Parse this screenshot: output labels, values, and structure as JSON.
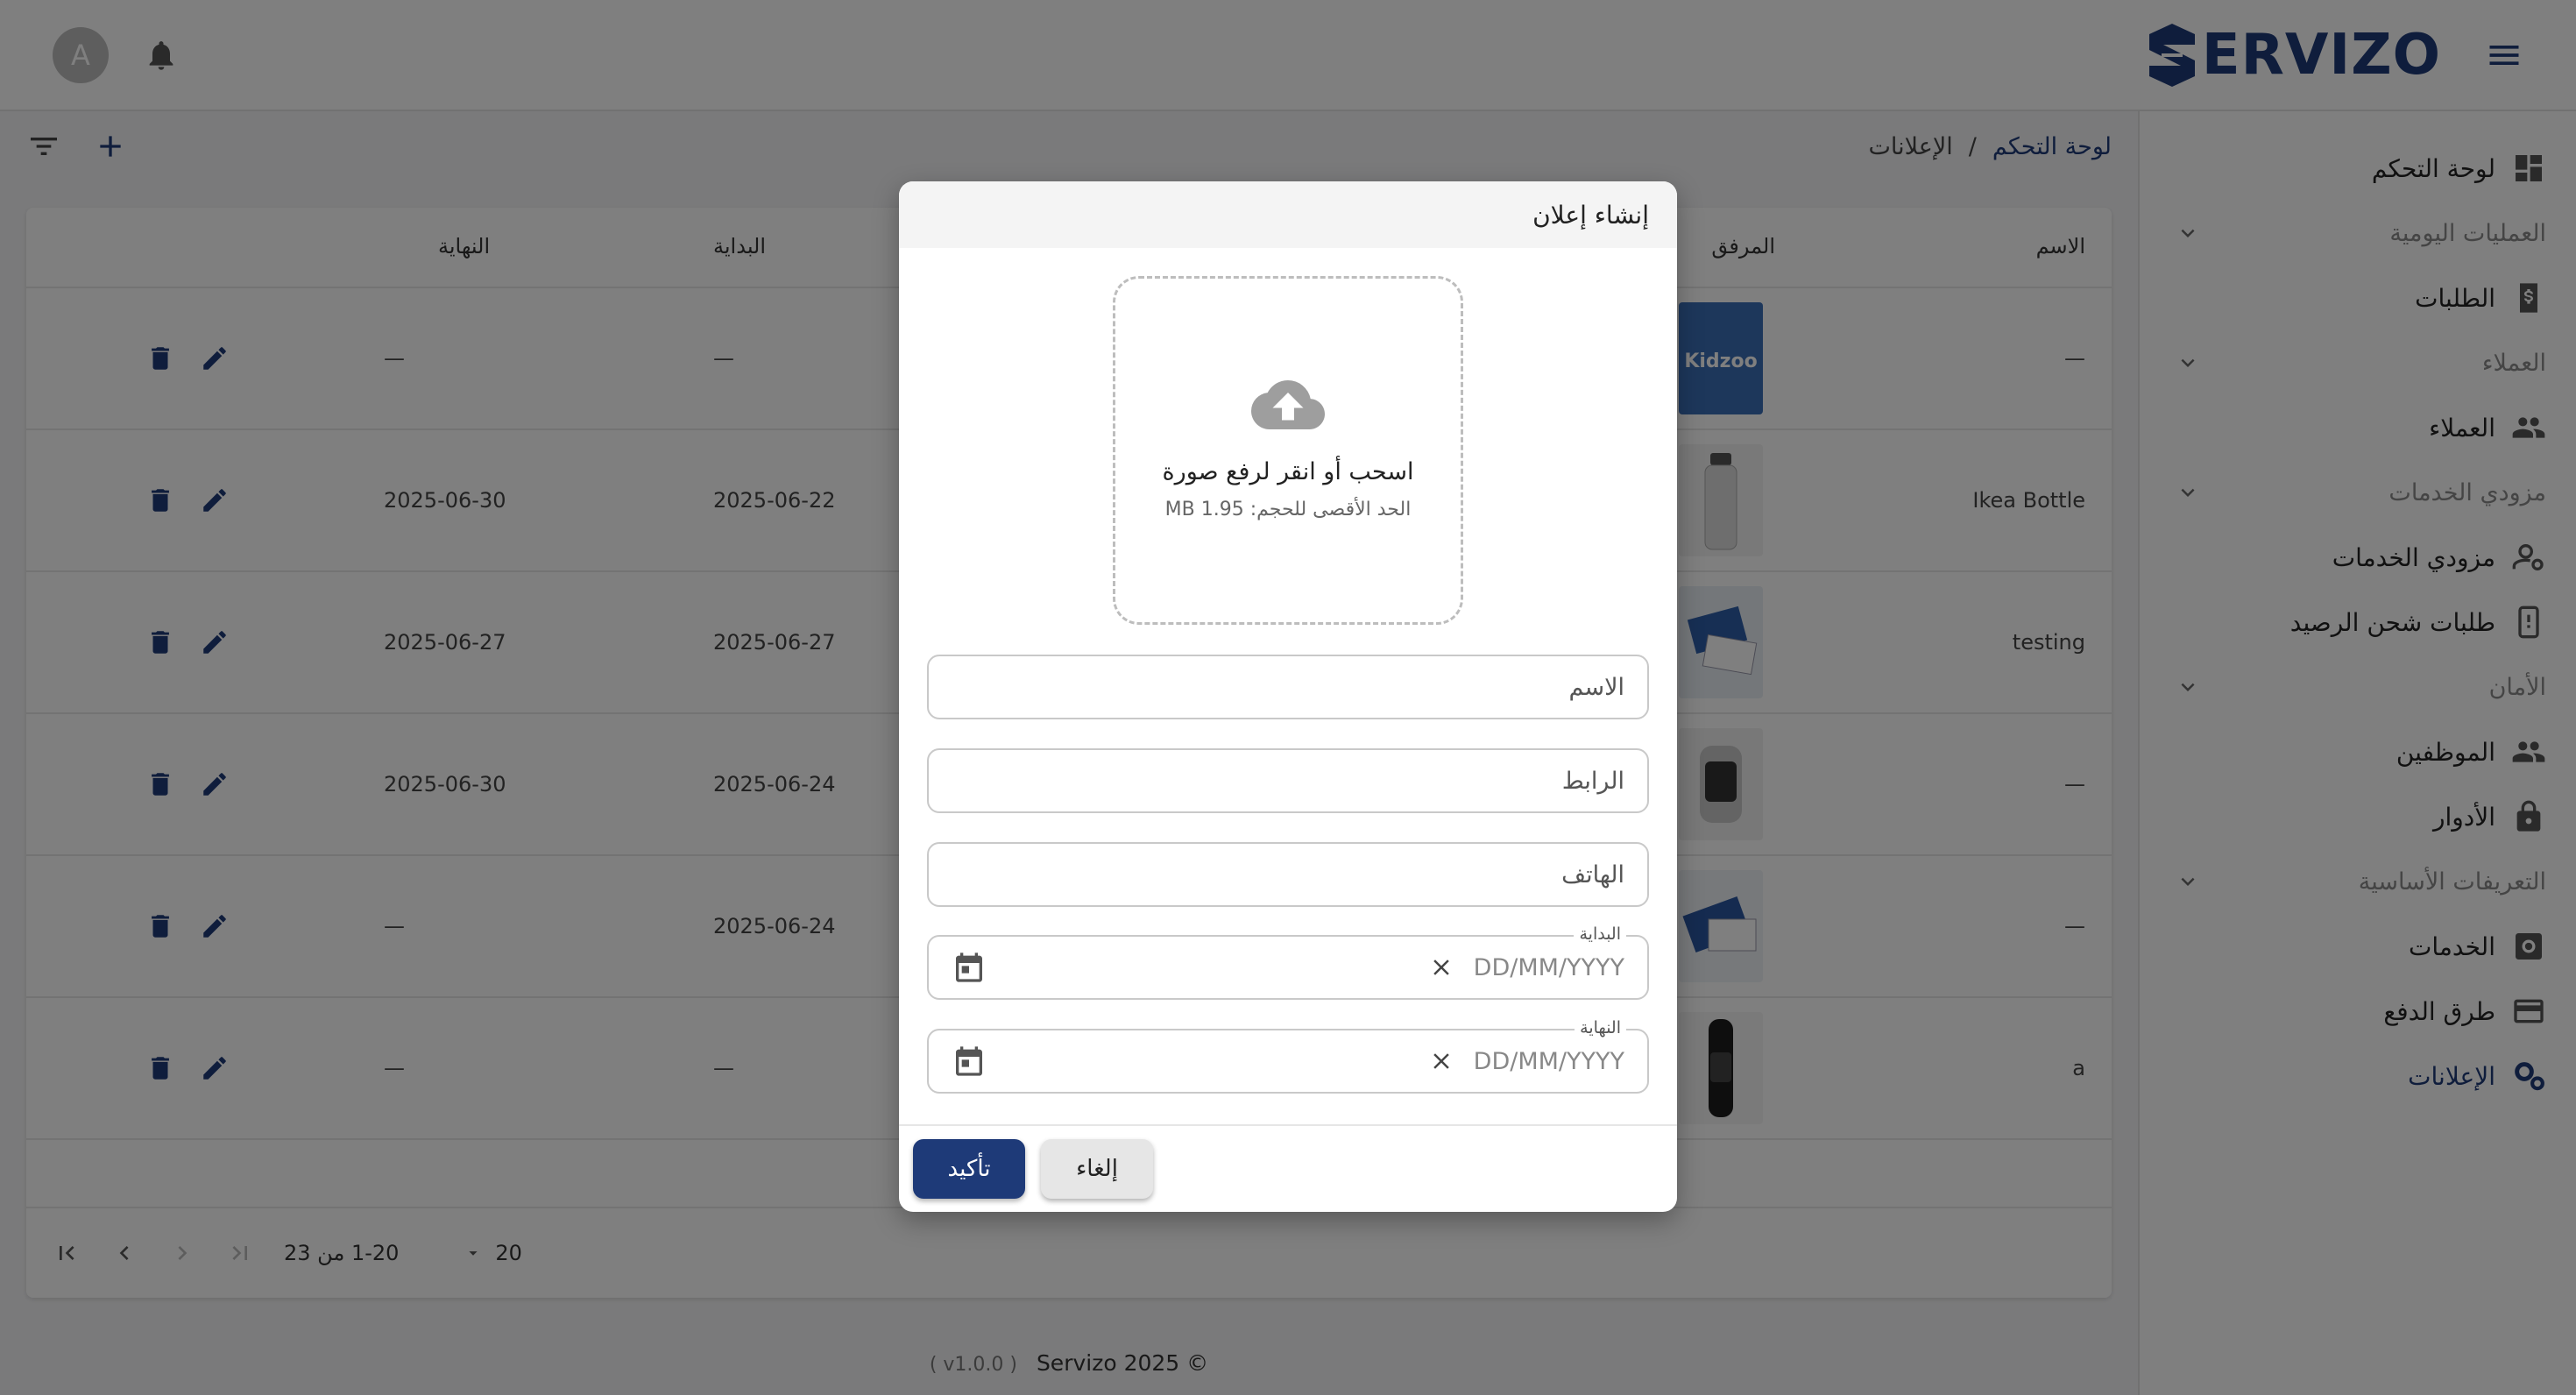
{
  "header": {
    "brand": "ERVIZO",
    "avatar_letter": "A"
  },
  "sidebar": {
    "items": [
      {
        "type": "item",
        "label": "لوحة التحكم",
        "icon": "dashboard-icon"
      },
      {
        "type": "section",
        "label": "العمليات اليومية"
      },
      {
        "type": "item",
        "label": "الطلبات",
        "icon": "receipt-icon"
      },
      {
        "type": "section",
        "label": "العملاء"
      },
      {
        "type": "item",
        "label": "العملاء",
        "icon": "people-icon"
      },
      {
        "type": "section",
        "label": "مزودي الخدمات"
      },
      {
        "type": "item",
        "label": "مزودي الخدمات",
        "icon": "manage-accounts-icon"
      },
      {
        "type": "item",
        "label": "طلبات شحن الرصيد",
        "icon": "charging-icon"
      },
      {
        "type": "section",
        "label": "الأمان"
      },
      {
        "type": "item",
        "label": "الموظفين",
        "icon": "people-icon"
      },
      {
        "type": "item",
        "label": "الأدوار",
        "icon": "lock-icon"
      },
      {
        "type": "section",
        "label": "التعريفات الأساسية"
      },
      {
        "type": "item",
        "label": "الخدمات",
        "icon": "settings-box-icon"
      },
      {
        "type": "item",
        "label": "طرق الدفع",
        "icon": "credit-card-icon"
      },
      {
        "type": "item",
        "label": "الإعلانات",
        "icon": "settings-gears-icon",
        "active": true
      }
    ]
  },
  "breadcrumb": {
    "home": "لوحة التحكم",
    "separator": "/",
    "current": "الإعلانات"
  },
  "table": {
    "headers": {
      "name": "الاسم",
      "attachment": "المرفق",
      "start": "البداية",
      "end": "النهاية"
    },
    "rows": [
      {
        "name": "—",
        "start": "—",
        "end": "—",
        "thumb": "kidzoo"
      },
      {
        "name": "Ikea Bottle",
        "start": "2025-06-22",
        "end": "2025-06-30",
        "thumb": "bottle"
      },
      {
        "name": "testing",
        "start": "2025-06-27",
        "end": "2025-06-27",
        "thumb": "cards"
      },
      {
        "name": "—",
        "start": "2025-06-24",
        "end": "2025-06-30",
        "thumb": "watch"
      },
      {
        "name": "—",
        "start": "2025-06-24",
        "end": "—",
        "thumb": "cards2"
      },
      {
        "name": "a",
        "start": "—",
        "end": "—",
        "thumb": "band"
      }
    ]
  },
  "pagination": {
    "page_size": "20",
    "range": "1-20 من 23"
  },
  "footer": {
    "copyright": "Servizo 2025 ©",
    "version": "( v1.0.0 )"
  },
  "modal": {
    "title": "إنشاء إعلان",
    "dropzone_title": "اسحب أو انقر لرفع صورة",
    "dropzone_hint": "الحد الأقصى للحجم: 1.95 MB",
    "name_placeholder": "الاسم",
    "link_placeholder": "الرابط",
    "phone_placeholder": "الهاتف",
    "start_label": "البداية",
    "end_label": "النهاية",
    "date_placeholder": "DD/MM/YYYY",
    "confirm": "تأكيد",
    "cancel": "إلغاء"
  },
  "colors": {
    "primary": "#1e3a78",
    "overlay": "rgba(0,0,0,0.5)"
  }
}
